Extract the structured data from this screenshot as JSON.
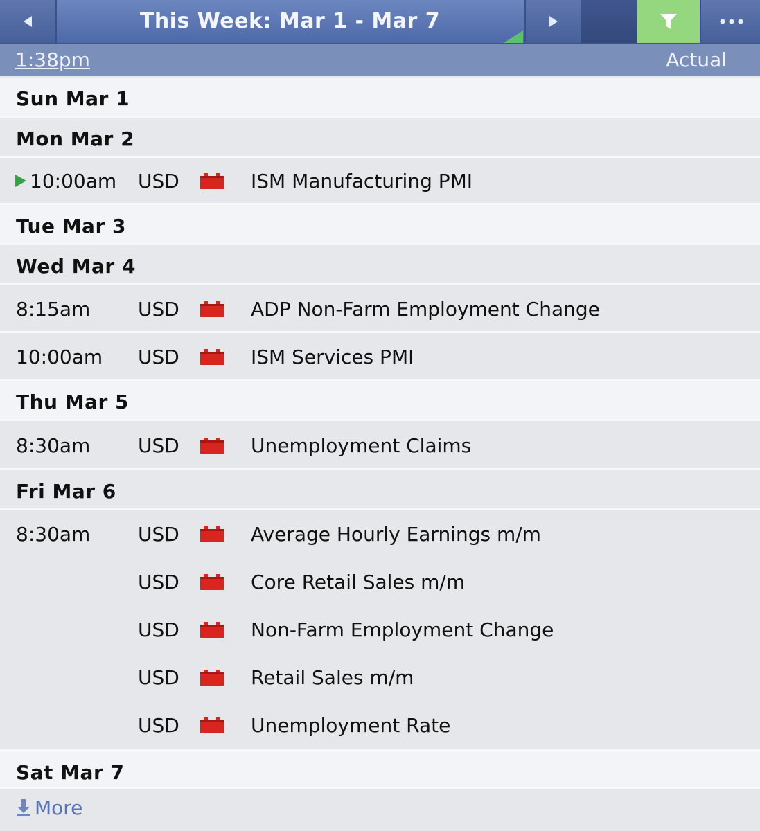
{
  "header": {
    "title": "This Week: Mar 1 - Mar 7",
    "prev_icon": "triangle-left-icon",
    "next_icon": "triangle-right-icon",
    "filter_icon": "funnel-icon",
    "more_icon": "ellipsis-icon"
  },
  "subheader": {
    "time": "1:38pm",
    "actual_label": "Actual"
  },
  "days": [
    {
      "label": "Sun Mar 1",
      "events": []
    },
    {
      "label": "Mon Mar 2",
      "events": [
        {
          "time": "10:00am",
          "currency": "USD",
          "name": "ISM Manufacturing PMI",
          "next_up": true
        }
      ]
    },
    {
      "label": "Tue Mar 3",
      "events": []
    },
    {
      "label": "Wed Mar 4",
      "events": [
        {
          "time": "8:15am",
          "currency": "USD",
          "name": "ADP Non-Farm Employment Change"
        },
        {
          "time": "10:00am",
          "currency": "USD",
          "name": "ISM Services PMI"
        }
      ]
    },
    {
      "label": "Thu Mar 5",
      "events": [
        {
          "time": "8:30am",
          "currency": "USD",
          "name": "Unemployment Claims"
        }
      ]
    },
    {
      "label": "Fri Mar 6",
      "events": [
        {
          "time": "8:30am",
          "currency": "USD",
          "name": "Average Hourly Earnings m/m"
        },
        {
          "time": "",
          "currency": "USD",
          "name": "Core Retail Sales m/m"
        },
        {
          "time": "",
          "currency": "USD",
          "name": "Non-Farm Employment Change"
        },
        {
          "time": "",
          "currency": "USD",
          "name": "Retail Sales m/m"
        },
        {
          "time": "",
          "currency": "USD",
          "name": "Unemployment Rate"
        }
      ]
    },
    {
      "label": "Sat Mar 7",
      "events": []
    }
  ],
  "impact": {
    "level": "high",
    "color": "#d8261f",
    "icon": "red-folder-impact-icon"
  },
  "footer": {
    "more_label": "More",
    "more_icon": "download-arrow-icon"
  },
  "colors": {
    "header_blue": "#5a72ad",
    "filter_green": "#95d77f",
    "link_blue": "#5673b8"
  }
}
